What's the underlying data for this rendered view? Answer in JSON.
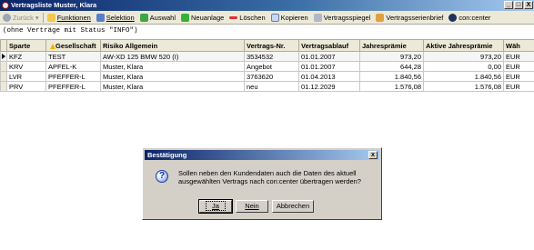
{
  "window": {
    "title": "Vertragsliste Muster, Klara",
    "minimize": "_",
    "maximize": "□",
    "close": "X"
  },
  "toolbar": {
    "back": "Zurück",
    "functions": "Funktionen",
    "selection": "Selektion",
    "choose": "Auswahl",
    "new": "Neuanlage",
    "delete": "Löschen",
    "copy": "Kopieren",
    "mirror": "Vertragsspiegel",
    "letter": "Vertragsserienbrief",
    "concenter": "con:center"
  },
  "filter_text": "(ohne Verträge mit Status \"INFO\")",
  "table": {
    "columns": [
      "Sparte",
      "Gesellschaft",
      "Risiko Allgemein",
      "Vertrags-Nr.",
      "Vertragsablauf",
      "Jahresprämie",
      "Aktive Jahresprämie",
      "Wäh"
    ],
    "rows": [
      [
        "KFZ",
        "TEST",
        "AW-XD 125 BMW 520 (I)",
        "3534532",
        "01.01.2007",
        "973,20",
        "973,20",
        "EUR"
      ],
      [
        "KRV",
        "APFEL-K",
        "Muster, Klara",
        "Angebot",
        "01.01.2007",
        "644,28",
        "0,00",
        "EUR"
      ],
      [
        "LVR",
        "PFEFFER-L",
        "Muster, Klara",
        "3763620",
        "01.04.2013",
        "1.840,56",
        "1.840,56",
        "EUR"
      ],
      [
        "PRV",
        "PFEFFER-L",
        "Muster, Klara",
        "neu",
        "01.12.2029",
        "1.576,08",
        "1.576,08",
        "EUR"
      ]
    ]
  },
  "dialog": {
    "title": "Bestätigung",
    "close": "x",
    "message": "Sollen neben den Kundendaten auch die Daten des aktuell ausgewählten Vertrags nach con:center übertragen werden?",
    "yes": "Ja",
    "no": "Nein",
    "cancel": "Abbrechen"
  }
}
